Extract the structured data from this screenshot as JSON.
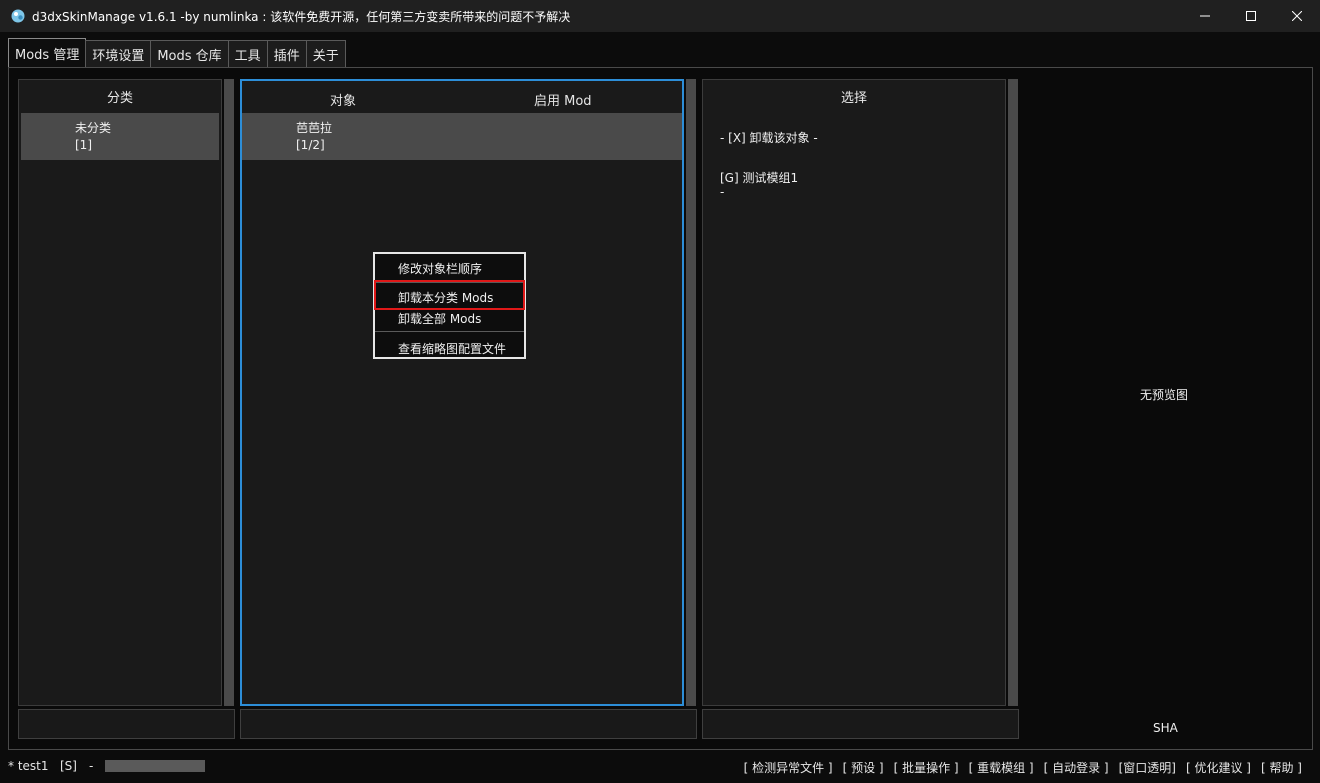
{
  "window": {
    "title": "d3dxSkinManage v1.6.1 -by numlinka : 该软件免费开源，任何第三方变卖所带来的问题不予解决"
  },
  "tabs": [
    {
      "label": "Mods 管理",
      "active": true
    },
    {
      "label": "环境设置",
      "active": false
    },
    {
      "label": "Mods 仓库",
      "active": false
    },
    {
      "label": "工具",
      "active": false
    },
    {
      "label": "插件",
      "active": false
    },
    {
      "label": "关于",
      "active": false
    }
  ],
  "category_panel": {
    "header": "分类",
    "items": [
      {
        "name": "未分类",
        "count": "[1]"
      }
    ]
  },
  "object_panel": {
    "header_object": "对象",
    "header_enabled": "启用 Mod",
    "items": [
      {
        "name": "芭芭拉",
        "count": "[1/2]"
      }
    ]
  },
  "select_panel": {
    "header": "选择",
    "lines": [
      "- [X] 卸载该对象 -",
      "[G] 测试模组1",
      "-"
    ]
  },
  "preview": {
    "no_preview": "无预览图",
    "sha": "SHA"
  },
  "context_menu": {
    "items": [
      "修改对象栏顺序",
      "卸载本分类 Mods",
      "卸载全部 Mods",
      "查看缩略图配置文件"
    ],
    "highlighted_index": 1
  },
  "statusbar": {
    "user": "* test1",
    "status": "[S]",
    "dash": "-",
    "progress": 1.0,
    "links": [
      "[ 检测异常文件 ]",
      "[ 预设 ]",
      "[ 批量操作 ]",
      "[ 重载模组 ]",
      "[ 自动登录 ]",
      "[窗口透明]",
      "[ 优化建议 ]",
      "[ 帮助 ]"
    ]
  },
  "colors": {
    "accent_border": "#2d8ed8",
    "highlight_red": "#e01818"
  }
}
